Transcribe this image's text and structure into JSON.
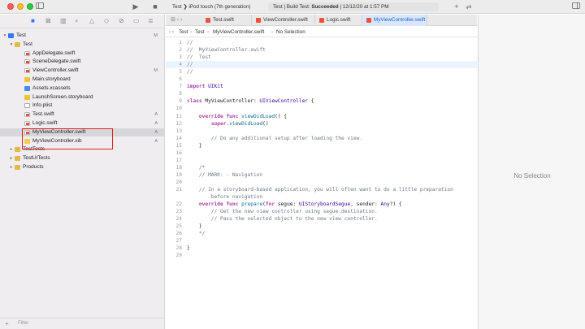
{
  "toolbar": {
    "scheme": "Test",
    "device": "iPod touch (7th generation)",
    "status_project": "Test",
    "status_action": "Build Test:",
    "status_result": "Succeeded",
    "status_time": "12/12/20 at 1:57 PM",
    "play_icon": "play-icon",
    "stop_icon": "stop-icon",
    "plus_icon": "plus-icon",
    "arrows_icon": "swap-arrows-icon",
    "sidebar_toggle_icon": "sidebar-toggle-icon"
  },
  "navigator": {
    "icons": [
      "folder-icon",
      "source-control-icon",
      "symbol-icon",
      "search-icon",
      "warning-icon",
      "test-icon",
      "debug-icon",
      "breakpoint-icon",
      "report-icon"
    ],
    "filter_placeholder": "Filter",
    "tree": [
      {
        "name": "Test",
        "icon": "proj",
        "level": 0,
        "disclosure": "▾",
        "badge": "M"
      },
      {
        "name": "Test",
        "icon": "folder",
        "level": 1,
        "disclosure": "▾",
        "badge": ""
      },
      {
        "name": "AppDelegate.swift",
        "icon": "swift",
        "level": 2,
        "disclosure": "",
        "badge": ""
      },
      {
        "name": "SceneDelegate.swift",
        "icon": "swift",
        "level": 2,
        "disclosure": "",
        "badge": ""
      },
      {
        "name": "ViewController.swift",
        "icon": "swift",
        "level": 2,
        "disclosure": "",
        "badge": "M"
      },
      {
        "name": "Main.storyboard",
        "icon": "sb",
        "level": 2,
        "disclosure": "",
        "badge": ""
      },
      {
        "name": "Assets.xcassets",
        "icon": "assets",
        "level": 2,
        "disclosure": "",
        "badge": ""
      },
      {
        "name": "LaunchScreen.storyboard",
        "icon": "sb",
        "level": 2,
        "disclosure": "",
        "badge": ""
      },
      {
        "name": "Info.plist",
        "icon": "plist",
        "level": 2,
        "disclosure": "",
        "badge": ""
      },
      {
        "name": "Test.swift",
        "icon": "swift",
        "level": 2,
        "disclosure": "",
        "badge": "A"
      },
      {
        "name": "Logic.swift",
        "icon": "swift",
        "level": 2,
        "disclosure": "",
        "badge": "A"
      },
      {
        "name": "MyViewController.swift",
        "icon": "swift",
        "level": 2,
        "disclosure": "",
        "badge": "A",
        "selected": true
      },
      {
        "name": "MyViewController.xib",
        "icon": "xib",
        "level": 2,
        "disclosure": "",
        "badge": "A"
      },
      {
        "name": "TestTests",
        "icon": "folder",
        "level": 1,
        "disclosure": "▸",
        "badge": ""
      },
      {
        "name": "TestUITests",
        "icon": "folder",
        "level": 1,
        "disclosure": "▸",
        "badge": ""
      },
      {
        "name": "Products",
        "icon": "folder",
        "level": 1,
        "disclosure": "▸",
        "badge": ""
      }
    ]
  },
  "tabs": [
    {
      "label": "Test.swift",
      "active": false
    },
    {
      "label": "ViewController.swift",
      "active": false
    },
    {
      "label": "Logic.swift",
      "active": false
    },
    {
      "label": "MyViewController.swift",
      "active": true
    }
  ],
  "breadcrumb": [
    "Test",
    "Test",
    "MyViewController.swift",
    "No Selection"
  ],
  "code": [
    {
      "n": "1",
      "t": "//"
    },
    {
      "n": "2",
      "t": "//  MyViewController.swift"
    },
    {
      "n": "3",
      "t": "//  Test"
    },
    {
      "n": "4",
      "t": "//"
    },
    {
      "n": "5",
      "t": "//"
    },
    {
      "n": "6",
      "t": ""
    },
    {
      "n": "7",
      "t": "import UIKit"
    },
    {
      "n": "8",
      "t": ""
    },
    {
      "n": "9",
      "t": "class MyViewController: UIViewController {"
    },
    {
      "n": "10",
      "t": ""
    },
    {
      "n": "11",
      "t": "    override func viewDidLoad() {"
    },
    {
      "n": "12",
      "t": "        super.viewDidLoad()"
    },
    {
      "n": "13",
      "t": ""
    },
    {
      "n": "14",
      "t": "        // Do any additional setup after loading the view."
    },
    {
      "n": "15",
      "t": "    }"
    },
    {
      "n": "16",
      "t": ""
    },
    {
      "n": "17",
      "t": ""
    },
    {
      "n": "18",
      "t": "    /*"
    },
    {
      "n": "19",
      "t": "    // MARK: - Navigation"
    },
    {
      "n": "20",
      "t": ""
    },
    {
      "n": "21",
      "t": "    // In a storyboard-based application, you will often want to do a little preparation"
    },
    {
      "n": "",
      "t": "        before navigation"
    },
    {
      "n": "22",
      "t": "    override func prepare(for segue: UIStoryboardSegue, sender: Any?) {"
    },
    {
      "n": "23",
      "t": "        // Get the new view controller using segue.destination."
    },
    {
      "n": "24",
      "t": "        // Pass the selected object to the new view controller."
    },
    {
      "n": "25",
      "t": "    }"
    },
    {
      "n": "26",
      "t": "    */"
    },
    {
      "n": "27",
      "t": ""
    },
    {
      "n": "28",
      "t": "}"
    },
    {
      "n": "29",
      "t": ""
    }
  ],
  "inspector": {
    "empty_label": "No Selection"
  },
  "colors": {
    "accent": "#3478f6",
    "highlight": "#e01e1e"
  }
}
